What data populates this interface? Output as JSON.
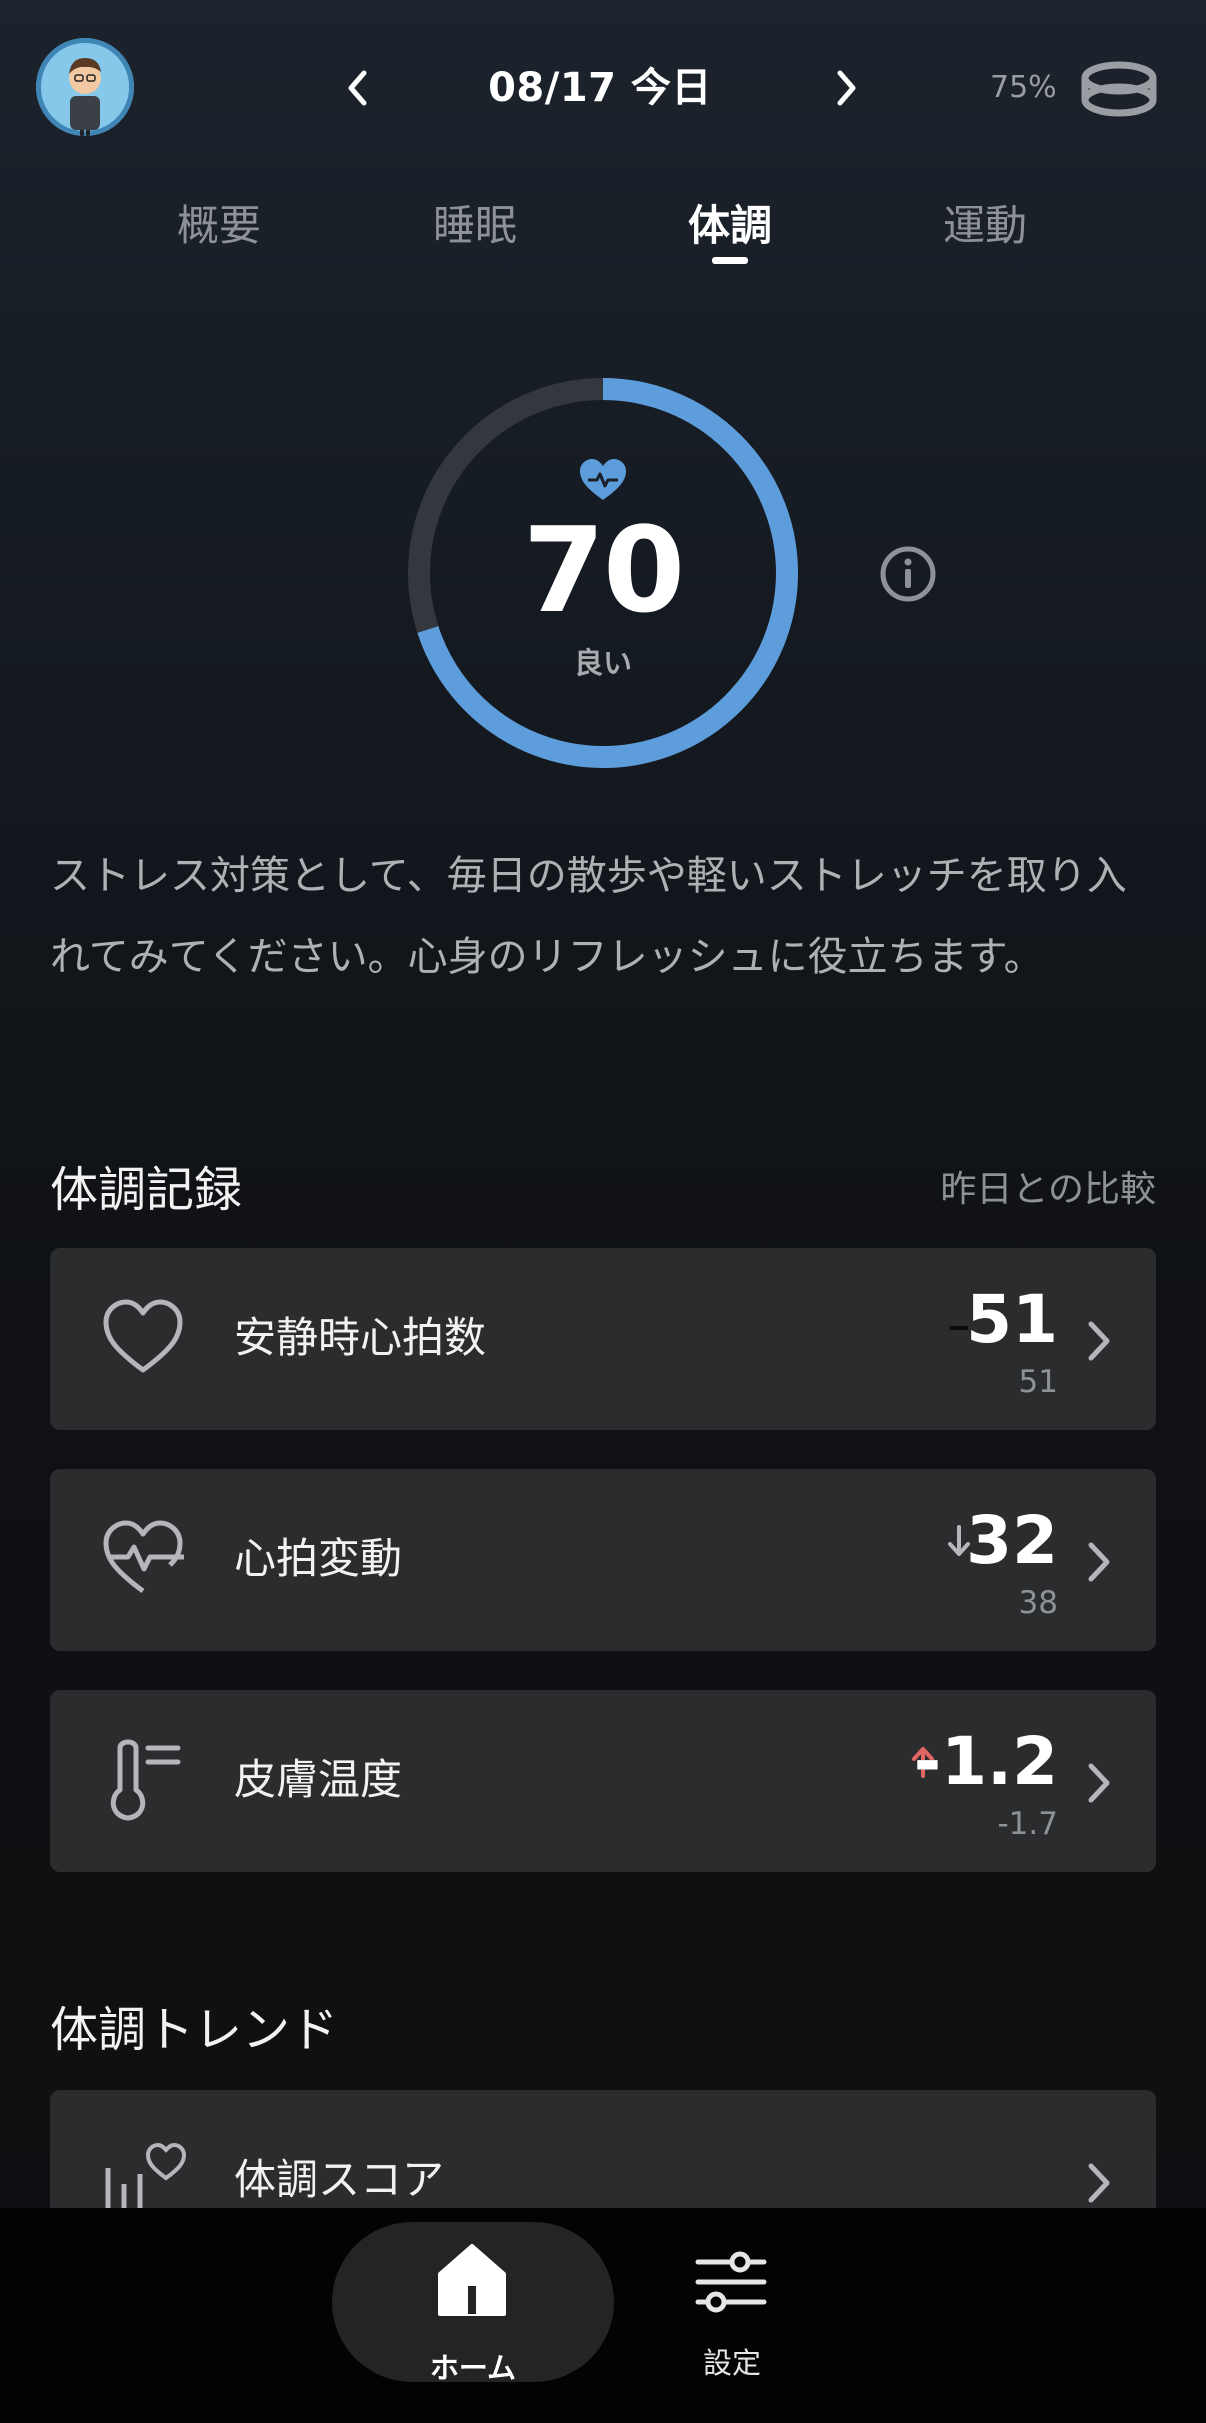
{
  "header": {
    "date_label": "08/17 今日",
    "battery": "75%",
    "icons": {
      "prev": "chevron-left-icon",
      "next": "chevron-right-icon",
      "ring": "smart-ring-icon",
      "avatar": "user-avatar"
    }
  },
  "tabs": [
    {
      "label": "概要",
      "active": false
    },
    {
      "label": "睡眠",
      "active": false
    },
    {
      "label": "体調",
      "active": true
    },
    {
      "label": "運動",
      "active": false
    }
  ],
  "score": {
    "value": "70",
    "label": "良い",
    "progress": 0.7,
    "colors": {
      "accent": "#5e9ddb",
      "track": "#34383e"
    }
  },
  "advice": "ストレス対策として、毎日の散歩や軽いストレッチを取り入れてみてください。心身のリフレッシュに役立ちます。",
  "records": {
    "title": "体調記録",
    "compare_label": "昨日との比較",
    "items": [
      {
        "label": "安静時心拍数",
        "value": "51",
        "previous": "51",
        "trend": "same",
        "icon": "heart-icon"
      },
      {
        "label": "心拍変動",
        "value": "32",
        "previous": "38",
        "trend": "down",
        "icon": "heart-pulse-icon"
      },
      {
        "label": "皮膚温度",
        "value": "-1.2",
        "previous": "-1.7",
        "trend": "up",
        "icon": "thermometer-icon",
        "trend_color": "#e06565"
      }
    ]
  },
  "trends": {
    "title": "体調トレンド",
    "items": [
      {
        "label": "体調スコア",
        "icon": "score-trend-icon"
      }
    ]
  },
  "bottom_nav": [
    {
      "label": "ホーム",
      "icon": "home-icon",
      "active": true
    },
    {
      "label": "設定",
      "icon": "settings-sliders-icon",
      "active": false
    }
  ]
}
